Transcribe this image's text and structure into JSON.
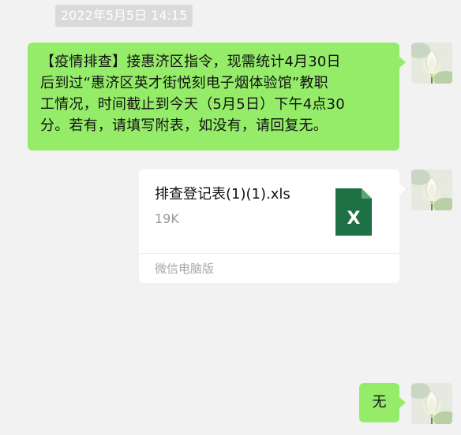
{
  "chat": {
    "timestamp": "2022年5月5日 14:15",
    "messages": [
      {
        "type": "text",
        "sender": "self",
        "text": "【疫情排查】接惠济区指令，现需统计4月30日\n后到过“惠济区英才街悦刻电子烟体验馆”教职\n工情况，时间截止到今天（5月5日）下午4点30\n分。若有，请填写附表，如没有，请回复无。"
      },
      {
        "type": "file",
        "sender": "self",
        "file_name": "排查登记表(1)(1).xls",
        "file_size": "19K",
        "source": "微信电脑版",
        "icon": "excel-file-icon",
        "icon_letter": "X",
        "icon_color": "#1f7145"
      },
      {
        "type": "text",
        "sender": "self",
        "text": "无"
      }
    ]
  },
  "theme": {
    "background": "#f2f2f2",
    "self_bubble": "#95ec69",
    "file_card": "#ffffff",
    "timestamp_bg": "#dadada"
  }
}
